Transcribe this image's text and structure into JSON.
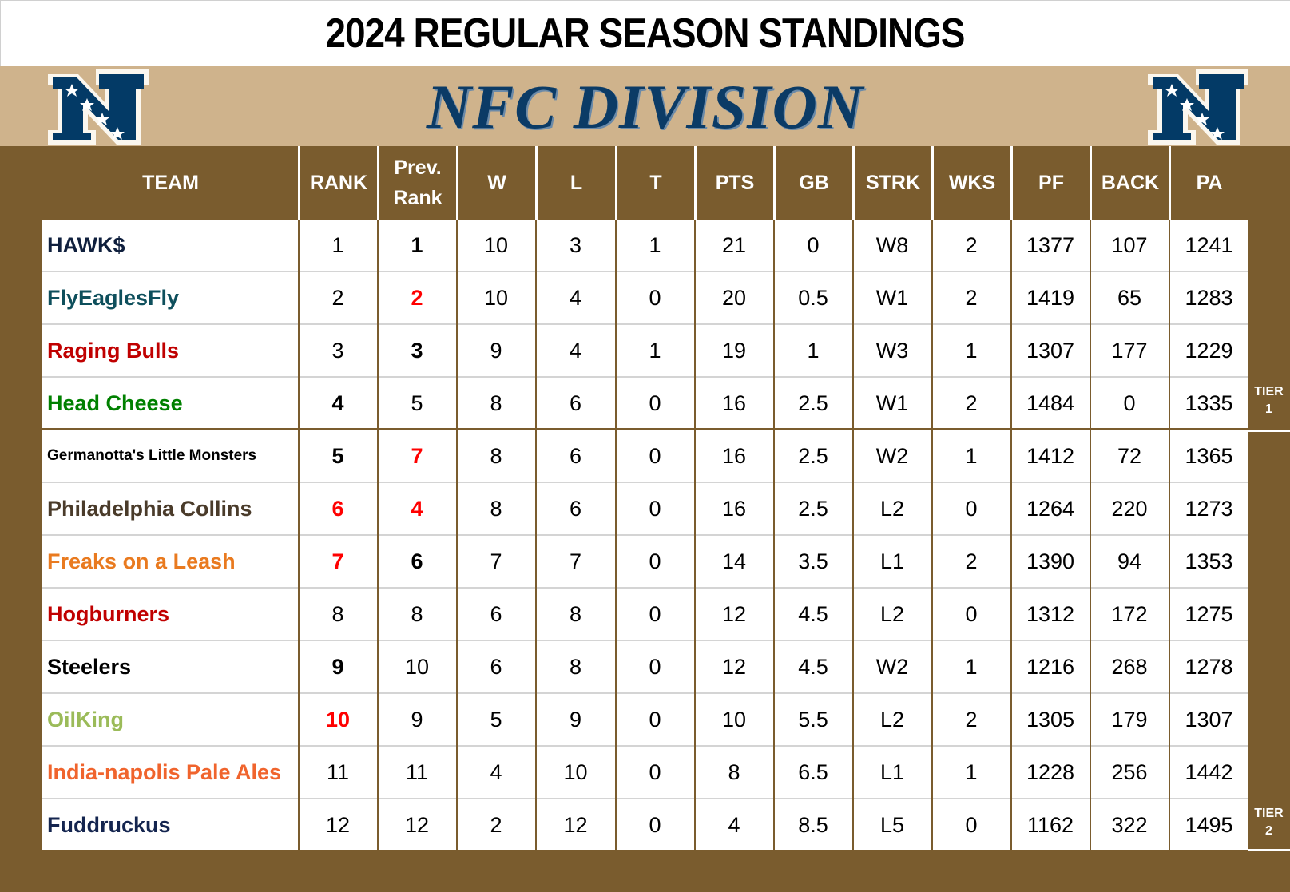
{
  "title": "2024 REGULAR SEASON STANDINGS",
  "division": "NFC DIVISION",
  "logo_icon": "nfc-shield-n-with-stars",
  "colors": {
    "header_bg": "#7a5c2e",
    "banner_bg": "#cfb38c",
    "division_text": "#0b3b66",
    "rank_change_highlight": "#ff0000"
  },
  "columns": [
    "TEAM",
    "RANK",
    "Prev. Rank",
    "W",
    "L",
    "T",
    "PTS",
    "GB",
    "STRK",
    "WKS",
    "PF",
    "BACK",
    "PA"
  ],
  "header": {
    "team": "TEAM",
    "rank": "RANK",
    "prev_line1": "Prev.",
    "prev_line2": "Rank",
    "w": "W",
    "l": "L",
    "t": "T",
    "pts": "PTS",
    "gb": "GB",
    "strk": "STRK",
    "wks": "WKS",
    "pf": "PF",
    "back": "BACK",
    "pa": "PA"
  },
  "tiers": [
    {
      "line1": "TIER",
      "line2": "1"
    },
    {
      "line1": "TIER",
      "line2": "2"
    }
  ],
  "rows": [
    {
      "team": "HAWK$",
      "team_color": "#0f1f3d",
      "rank": "1",
      "rank_style": "normal",
      "prev": "1",
      "prev_style": "bold",
      "w": "10",
      "l": "3",
      "t": "1",
      "pts": "21",
      "gb": "0",
      "strk": "W8",
      "wks": "2",
      "pf": "1377",
      "back": "107",
      "pa": "1241"
    },
    {
      "team": "FlyEaglesFly",
      "team_color": "#0e4f5c",
      "rank": "2",
      "rank_style": "normal",
      "prev": "2",
      "prev_style": "red",
      "w": "10",
      "l": "4",
      "t": "0",
      "pts": "20",
      "gb": "0.5",
      "strk": "W1",
      "wks": "2",
      "pf": "1419",
      "back": "65",
      "pa": "1283"
    },
    {
      "team": "Raging Bulls",
      "team_color": "#c00000",
      "rank": "3",
      "rank_style": "normal",
      "prev": "3",
      "prev_style": "bold",
      "w": "9",
      "l": "4",
      "t": "1",
      "pts": "19",
      "gb": "1",
      "strk": "W3",
      "wks": "1",
      "pf": "1307",
      "back": "177",
      "pa": "1229"
    },
    {
      "team": "Head Cheese",
      "team_color": "#008000",
      "rank": "4",
      "rank_style": "bold",
      "prev": "5",
      "prev_style": "normal",
      "w": "8",
      "l": "6",
      "t": "0",
      "pts": "16",
      "gb": "2.5",
      "strk": "W1",
      "wks": "2",
      "pf": "1484",
      "back": "0",
      "pa": "1335"
    },
    {
      "team": "Germanotta's Little Monsters",
      "team_color": "#000000",
      "rank": "5",
      "rank_style": "bold",
      "prev": "7",
      "prev_style": "red",
      "w": "8",
      "l": "6",
      "t": "0",
      "pts": "16",
      "gb": "2.5",
      "strk": "W2",
      "wks": "1",
      "pf": "1412",
      "back": "72",
      "pa": "1365"
    },
    {
      "team": "Philadelphia Collins",
      "team_color": "#4a3b2a",
      "rank": "6",
      "rank_style": "red",
      "prev": "4",
      "prev_style": "red",
      "w": "8",
      "l": "6",
      "t": "0",
      "pts": "16",
      "gb": "2.5",
      "strk": "L2",
      "wks": "0",
      "pf": "1264",
      "back": "220",
      "pa": "1273"
    },
    {
      "team": "Freaks on a Leash",
      "team_color": "#e97a1f",
      "rank": "7",
      "rank_style": "red",
      "prev": "6",
      "prev_style": "bold",
      "w": "7",
      "l": "7",
      "t": "0",
      "pts": "14",
      "gb": "3.5",
      "strk": "L1",
      "wks": "2",
      "pf": "1390",
      "back": "94",
      "pa": "1353"
    },
    {
      "team": "Hogburners",
      "team_color": "#c00000",
      "rank": "8",
      "rank_style": "normal",
      "prev": "8",
      "prev_style": "normal",
      "w": "6",
      "l": "8",
      "t": "0",
      "pts": "12",
      "gb": "4.5",
      "strk": "L2",
      "wks": "0",
      "pf": "1312",
      "back": "172",
      "pa": "1275"
    },
    {
      "team": "Steelers",
      "team_color": "#000000",
      "rank": "9",
      "rank_style": "bold",
      "prev": "10",
      "prev_style": "normal",
      "w": "6",
      "l": "8",
      "t": "0",
      "pts": "12",
      "gb": "4.5",
      "strk": "W2",
      "wks": "1",
      "pf": "1216",
      "back": "268",
      "pa": "1278"
    },
    {
      "team": "OilKing",
      "team_color": "#9bbb59",
      "rank": "10",
      "rank_style": "red",
      "prev": "9",
      "prev_style": "normal",
      "w": "5",
      "l": "9",
      "t": "0",
      "pts": "10",
      "gb": "5.5",
      "strk": "L2",
      "wks": "2",
      "pf": "1305",
      "back": "179",
      "pa": "1307"
    },
    {
      "team": "India-napolis Pale Ales",
      "team_color": "#f0642d",
      "rank": "11",
      "rank_style": "normal",
      "prev": "11",
      "prev_style": "normal",
      "w": "4",
      "l": "10",
      "t": "0",
      "pts": "8",
      "gb": "6.5",
      "strk": "L1",
      "wks": "1",
      "pf": "1228",
      "back": "256",
      "pa": "1442"
    },
    {
      "team": "Fuddruckus",
      "team_color": "#14254f",
      "rank": "12",
      "rank_style": "normal",
      "prev": "12",
      "prev_style": "normal",
      "w": "2",
      "l": "12",
      "t": "0",
      "pts": "4",
      "gb": "8.5",
      "strk": "L5",
      "wks": "0",
      "pf": "1162",
      "back": "322",
      "pa": "1495"
    }
  ]
}
